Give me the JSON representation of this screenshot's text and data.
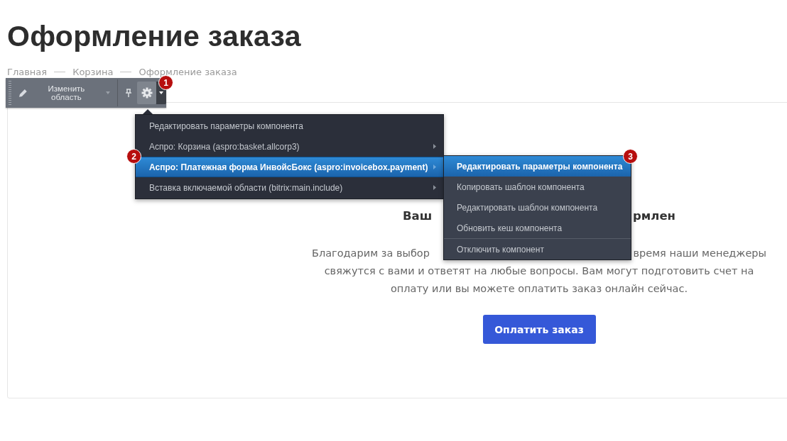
{
  "page_title": "Оформление заказа",
  "breadcrumbs": [
    {
      "label": "Главная"
    },
    {
      "label": "Корзина"
    },
    {
      "label": "Оформление заказа"
    }
  ],
  "toolbar": {
    "edit_area": "Изменить область"
  },
  "badges": [
    "1",
    "2",
    "3"
  ],
  "menu": [
    {
      "label": "Редактировать параметры компонента",
      "submenu": false,
      "selected": false
    },
    {
      "label": "Аспро: Корзина (aspro:basket.allcorp3)",
      "submenu": true,
      "selected": false
    },
    {
      "label": "Аспро: Платежная форма ИнвойсБокс (aspro:invoicebox.payment)",
      "submenu": true,
      "selected": true
    },
    {
      "label": "Вставка включаемой области (bitrix:main.include)",
      "submenu": true,
      "selected": false
    }
  ],
  "submenu": [
    {
      "label": "Редактировать параметры компонента",
      "selected": true,
      "separator_before": false
    },
    {
      "label": "Копировать шаблон компонента",
      "selected": false,
      "separator_before": false
    },
    {
      "label": "Редактировать шаблон компонента",
      "selected": false,
      "separator_before": false
    },
    {
      "label": "Обновить кеш компонента",
      "selected": false,
      "separator_before": false
    },
    {
      "label": "Отключить компонент",
      "selected": false,
      "separator_before": true
    }
  ],
  "order": {
    "heading_parts": [
      "Ваш",
      "рмлен"
    ],
    "text_first_line_parts": [
      "Благодарим за выбор",
      "время наши менеджеры"
    ],
    "text_lines": [
      "свяжутся с вами и ответят на любые вопросы. Вам могут подготовить счет на",
      "оплату или вы можете оплатить заказ онлайн сейчас."
    ],
    "pay_button": "Оплатить заказ"
  }
}
